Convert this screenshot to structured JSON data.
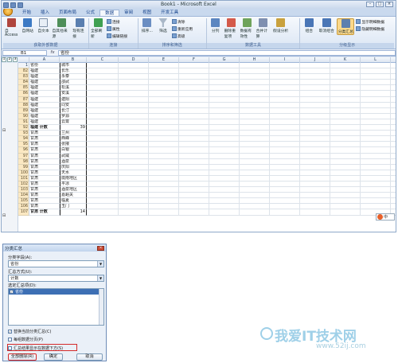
{
  "window": {
    "title": "Book1 - Microsoft Excel",
    "controls": [
      "–",
      "□",
      "×"
    ]
  },
  "tabs": [
    "开始",
    "插入",
    "页面布局",
    "公式",
    "数据",
    "审阅",
    "视图",
    "开发工具"
  ],
  "active_tab": "数据",
  "ribbon": {
    "groups": [
      {
        "label": "获取外部数据",
        "buttons": [
          "自 Access",
          "自网站",
          "自文本",
          "自其他来源",
          "现有连接"
        ]
      },
      {
        "label": "连接",
        "buttons": [
          "全部刷新"
        ],
        "small": [
          "连接",
          "属性",
          "编辑链接"
        ]
      },
      {
        "label": "排序和筛选",
        "buttons": [
          "排序...",
          "筛选"
        ],
        "small": [
          "清除",
          "重新应用",
          "高级"
        ]
      },
      {
        "label": "数据工具",
        "buttons": [
          "分列",
          "删除重复项",
          "数据有效性",
          "合并计算",
          "假设分析"
        ]
      },
      {
        "label": "分级显示",
        "buttons": [
          "组合",
          "取消组合",
          "分类汇总"
        ],
        "small": [
          "显示明细数据",
          "隐藏明细数据"
        ]
      }
    ]
  },
  "formula_bar": {
    "name_box": "B1",
    "fx": "fx",
    "value": "省份"
  },
  "outline_levels": [
    "1",
    "2",
    "3"
  ],
  "columns": [
    "A",
    "B",
    "C",
    "D",
    "E",
    "F",
    "G",
    "H",
    "I",
    "J",
    "K",
    "L",
    "M",
    "N",
    "O"
  ],
  "sheet_rows": [
    {
      "num": "1",
      "a": "省份",
      "b": "城市",
      "bold": false
    },
    {
      "num": "82",
      "a": "福建",
      "b": "长乐",
      "bold": false
    },
    {
      "num": "83",
      "a": "福建",
      "b": "永泰",
      "bold": false
    },
    {
      "num": "84",
      "a": "福建",
      "b": "邵武",
      "bold": false
    },
    {
      "num": "85",
      "a": "福建",
      "b": "松溪",
      "bold": false
    },
    {
      "num": "86",
      "a": "福建",
      "b": "安溪",
      "bold": false
    },
    {
      "num": "87",
      "a": "福建",
      "b": "建阳",
      "bold": false
    },
    {
      "num": "88",
      "a": "福建",
      "b": "同安",
      "bold": false
    },
    {
      "num": "89",
      "a": "福建",
      "b": "长汀",
      "bold": false
    },
    {
      "num": "90",
      "a": "福建",
      "b": "罗源",
      "bold": false
    },
    {
      "num": "91",
      "a": "福建",
      "b": "云霄",
      "bold": false
    },
    {
      "num": "92",
      "a": "福建 计数",
      "b": "39",
      "bold": true
    },
    {
      "num": "93",
      "a": "甘肃",
      "b": "兰州",
      "bold": false
    },
    {
      "num": "94",
      "a": "甘肃",
      "b": "西峰",
      "bold": false
    },
    {
      "num": "95",
      "a": "甘肃",
      "b": "张掖",
      "bold": false
    },
    {
      "num": "96",
      "a": "甘肃",
      "b": "白银",
      "bold": false
    },
    {
      "num": "97",
      "a": "甘肃",
      "b": "武威",
      "bold": false
    },
    {
      "num": "98",
      "a": "甘肃",
      "b": "酒泉",
      "bold": false
    },
    {
      "num": "99",
      "a": "甘肃",
      "b": "庆阳",
      "bold": false
    },
    {
      "num": "100",
      "a": "甘肃",
      "b": "天水",
      "bold": false
    },
    {
      "num": "101",
      "a": "甘肃",
      "b": "陇南地区",
      "bold": false
    },
    {
      "num": "102",
      "a": "甘肃",
      "b": "平凉",
      "bold": false
    },
    {
      "num": "103",
      "a": "甘肃",
      "b": "酒泉地区",
      "bold": false
    },
    {
      "num": "104",
      "a": "甘肃",
      "b": "嘉峪关",
      "bold": false
    },
    {
      "num": "105",
      "a": "甘肃",
      "b": "临夏",
      "bold": false
    },
    {
      "num": "106",
      "a": "甘肃",
      "b": "玉门",
      "bold": false
    },
    {
      "num": "107",
      "a": "甘肃 计数",
      "b": "14",
      "bold": true
    }
  ],
  "ime": {
    "label": "中"
  },
  "dialog": {
    "title": "分类汇总",
    "close": "×",
    "group_by_label": "分类字段(A):",
    "group_by_value": "省份",
    "function_label": "汇总方式(U):",
    "function_value": "计数",
    "items_label": "选定汇总项(D):",
    "items": [
      {
        "label": "省份",
        "checked": true,
        "selected": true
      }
    ],
    "opt_replace": {
      "label": "替换当前分类汇总(C)",
      "checked": true
    },
    "opt_pagebreak": {
      "label": "每组数据分页(P)",
      "checked": false
    },
    "opt_summary_below": {
      "label": "汇总结果显示在数据下方(S)",
      "checked": false
    },
    "remove_all": "全部删除(R)",
    "ok": "确定",
    "cancel": "取消"
  },
  "watermark": {
    "text": "我爱IT技术网",
    "url": "www.52ij.com"
  }
}
